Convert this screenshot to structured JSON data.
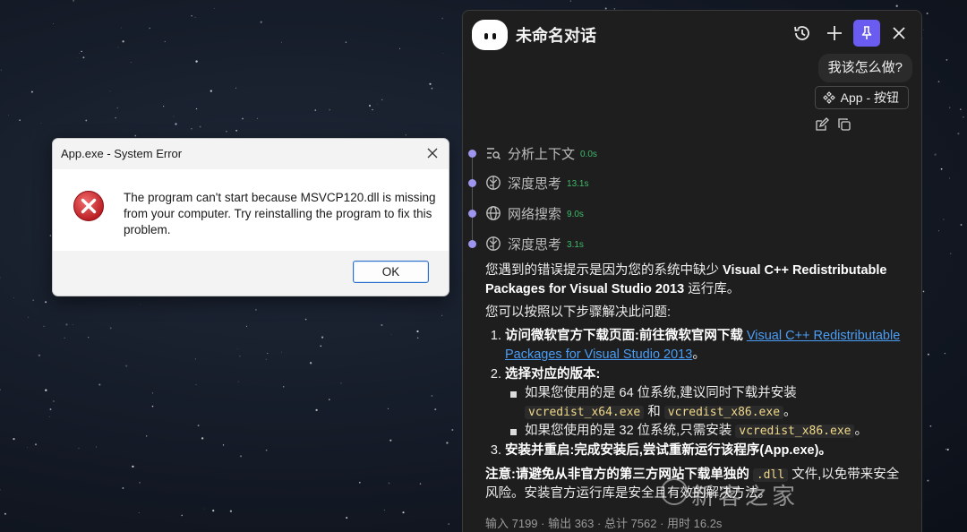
{
  "dialog": {
    "title": "App.exe - System Error",
    "message": "The program can't start because MSVCP120.dll is missing from your computer. Try reinstalling the program to fix this problem.",
    "ok_label": "OK",
    "icon": "error-x-icon"
  },
  "panel": {
    "title": "未命名对话",
    "header_icons": [
      "history-icon",
      "plus-icon",
      "pin-icon",
      "close-icon"
    ],
    "user_message": "我该怎么做?",
    "app_chip": "App - 按钮",
    "steps": [
      {
        "label": "分析上下文",
        "time": "0.0s",
        "icon": "context-search-icon"
      },
      {
        "label": "深度思考",
        "time": "13.1s",
        "icon": "brain-icon"
      },
      {
        "label": "网络搜索",
        "time": "9.0s",
        "icon": "globe-icon"
      },
      {
        "label": "深度思考",
        "time": "3.1s",
        "icon": "brain-icon"
      }
    ],
    "answer": {
      "intro_a": "您遇到的错误提示是因为您的系统中缺少 ",
      "intro_b": "Visual C++ Redistributable Packages for Visual Studio 2013",
      "intro_c": " 运行库。",
      "lead": "您可以按照以下步骤解决此问题:",
      "s1_title": "访问微软官方下载页面:",
      "s1_text": "前往微软官网下载 ",
      "s1_link": "Visual C++ Redistributable Packages for Visual Studio 2013",
      "s1_end": "。",
      "s2_title": "选择对应的版本:",
      "s2_b1_a": "如果您使用的是 64 位系统,建议同时下载并安装 ",
      "s2_b1_code1": "vcredist_x64.exe",
      "s2_b1_mid": " 和 ",
      "s2_b1_code2": "vcredist_x86.exe",
      "s2_b1_end": "。",
      "s2_b2_a": "如果您使用的是 32 位系统,只需安装 ",
      "s2_b2_code": "vcredist_x86.exe",
      "s2_b2_end": "。",
      "s3_title": "安装并重启:",
      "s3_text": "完成安装后,尝试重新运行该程序(App.exe)。",
      "note_bold": "注意:请避免从非官方的第三方网站下载单独的 ",
      "note_code": ".dll",
      "note_bold2": " 文件,",
      "note_text": "以免带来安全风险。安装官方运行库是安全且有效的解决方法。"
    },
    "usage": "输入 7199 · 输出 363 · 总计 7562 · 用时 16.2s"
  },
  "watermark": "新客之家"
}
